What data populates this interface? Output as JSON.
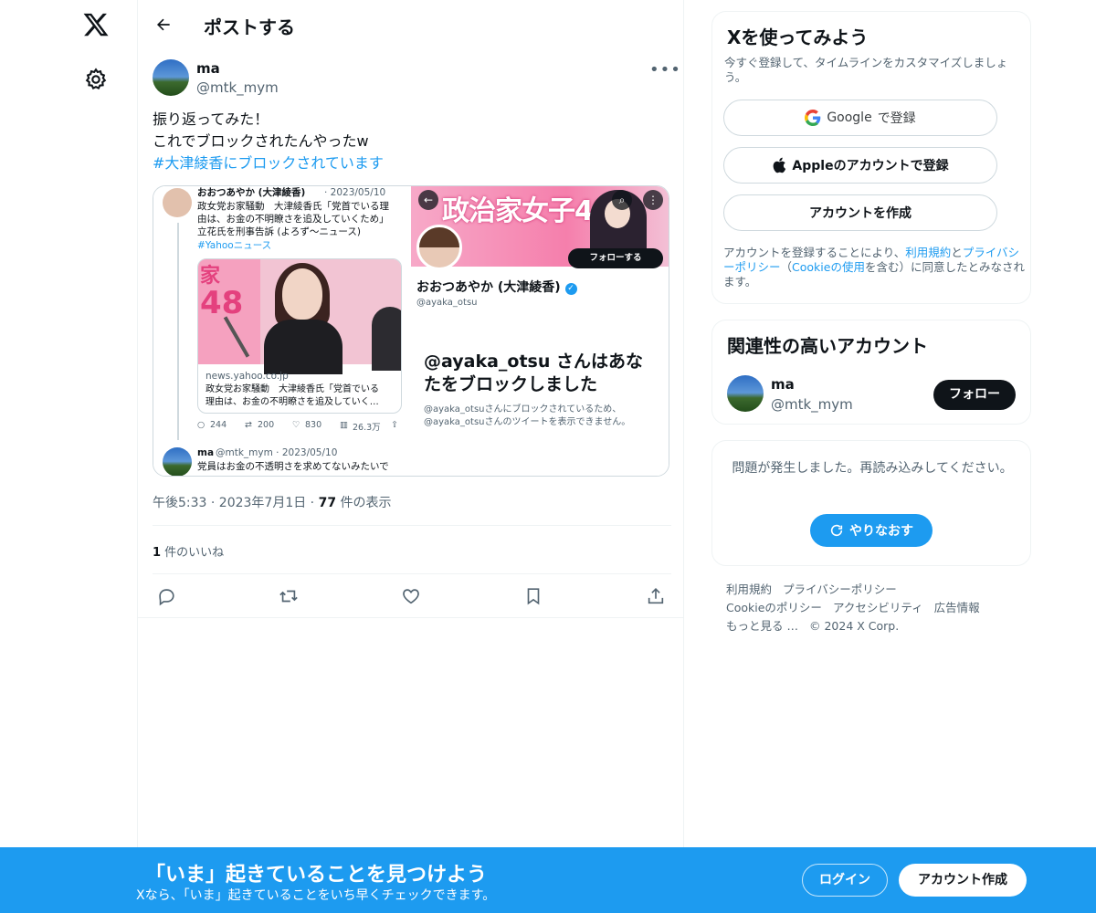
{
  "header": {
    "title": "ポストする"
  },
  "post": {
    "author_name": "ma",
    "author_handle": "@mtk_mym",
    "lines": [
      "振り返ってみた！",
      "これでブロックされたんやったw"
    ],
    "hashtag": "#大津綾香にブロックされています",
    "time": "午後5:33 · 2023年7月1日 · ",
    "views_count": "77",
    "views_label": " 件の表示",
    "likes_count": "1",
    "likes_label": " 件のいいね"
  },
  "media": {
    "left": {
      "name_line": "おおつあやか (大津綾香)",
      "date": "· 2023/05/10",
      "text_lines": [
        "政女党お家騒動　大津綾香氏「党首でいる理",
        "由は、お金の不明瞭さを追及していくため」",
        "立花氏を刑事告訴 (よろず〜ニュース)"
      ],
      "hashtag": "#Yahooニュース",
      "photo_kanji": "家",
      "photo_number": "48",
      "card_domain": "news.yahoo.co.jp",
      "card_lines": [
        "政女党お家騒動　大津綾香氏「党首でいる",
        "理由は、お金の不明瞭さを追及していく…"
      ],
      "stats": {
        "replies": "244",
        "reposts": "200",
        "likes": "830",
        "views": "26.3万"
      },
      "reply_name": "ma",
      "reply_meta": "@mtk_mym · 2023/05/10",
      "reply_text": "党員はお金の不透明さを求めてないみたいで"
    },
    "right": {
      "banner_text": "政治家女子48",
      "follow_label": "フォローする",
      "profile_name": "おおつあやか (大津綾香)",
      "profile_handle": "@ayaka_otsu",
      "blocked_line1": "@ayaka_otsu さんはあな",
      "blocked_line2": "たをブロックしました",
      "blocked_sub1": "@ayaka_otsuさんにブロックされているため、",
      "blocked_sub2": "@ayaka_otsuさんのツイートを表示できません。"
    }
  },
  "signup": {
    "title": "Xを使ってみよう",
    "subtitle": "今すぐ登録して、タイムラインをカスタマイズしましょう。",
    "google_label": "Google",
    "google_suffix": "で登録",
    "apple_label": "Appleのアカウントで登録",
    "create_label": "アカウントを作成",
    "terms_prefix": "アカウントを登録することにより、",
    "terms_link1": "利用規約",
    "terms_and": "と",
    "terms_link2": "プライバシーポリシー",
    "terms_mid": "（",
    "terms_link3": "Cookieの使用",
    "terms_suffix": "を含む）に同意したとみなされます。"
  },
  "related": {
    "title": "関連性の高いアカウント",
    "name": "ma",
    "handle": "@mtk_mym",
    "follow_label": "フォロー"
  },
  "error": {
    "message": "問題が発生しました。再読み込みしてください。",
    "retry_label": "やりなおす"
  },
  "footer": {
    "links": [
      "利用規約",
      "プライバシーポリシー",
      "Cookieのポリシー",
      "アクセシビリティ",
      "広告情報",
      "もっと見る …",
      "© 2024 X Corp."
    ]
  },
  "bottom_bar": {
    "title": "「いま」起きていることを見つけよう",
    "subtitle": "Xなら、「いま」起きていることをいち早くチェックできます。",
    "login_label": "ログイン",
    "signup_label": "アカウント作成"
  },
  "colors": {
    "accent": "#1d9bf0",
    "text": "#0f1419",
    "secondary": "#536471",
    "border": "#eff3f4"
  }
}
